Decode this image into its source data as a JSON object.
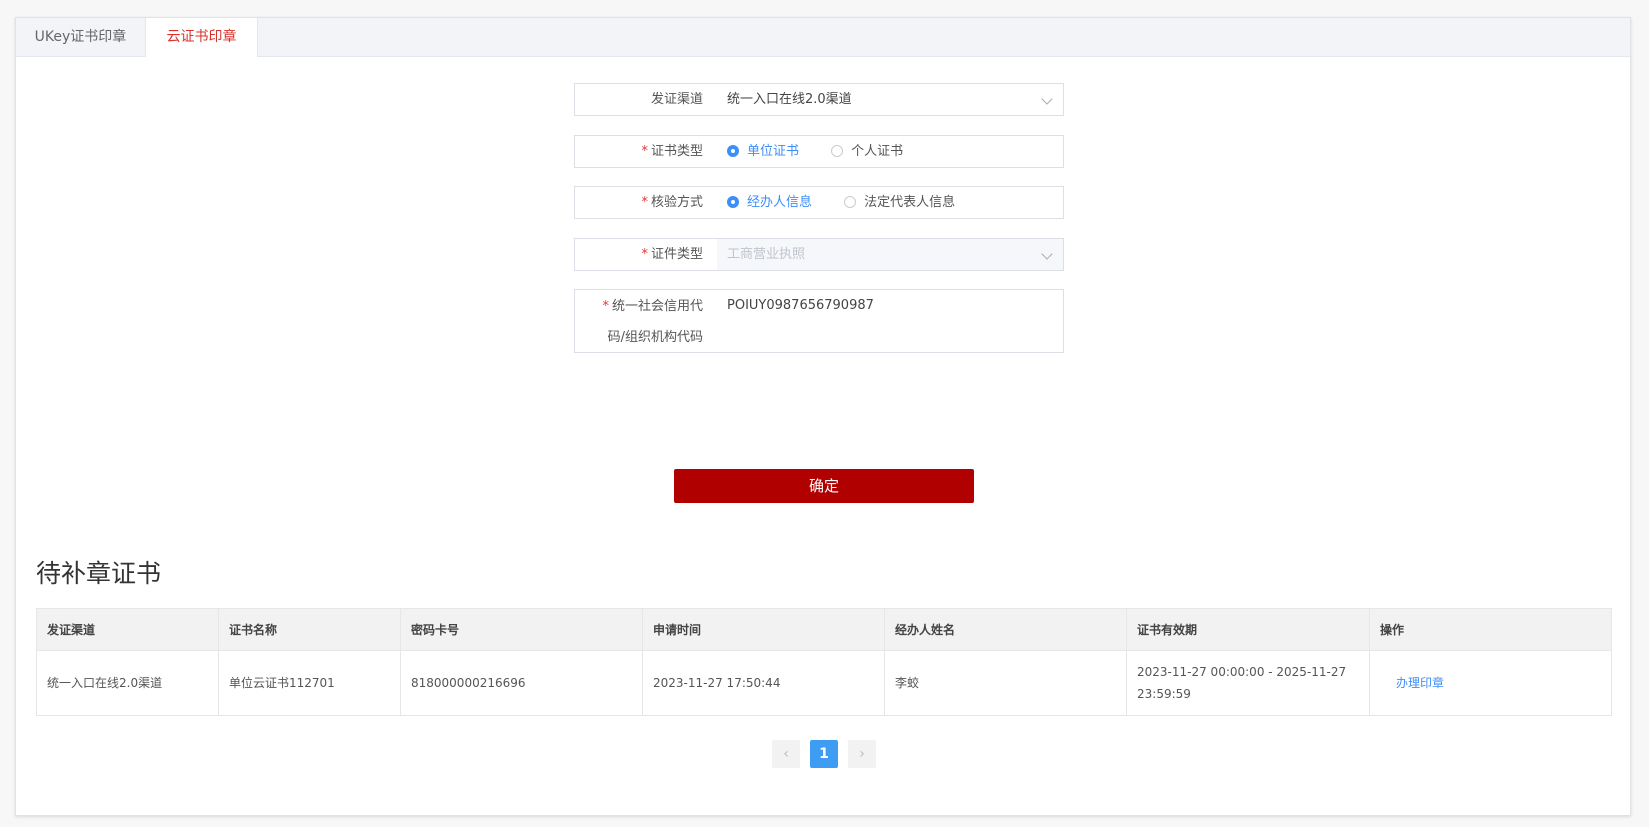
{
  "tabs": [
    {
      "label": "UKey证书印章",
      "active": false
    },
    {
      "label": "云证书印章",
      "active": true
    }
  ],
  "form": {
    "channel": {
      "label": "发证渠道",
      "value": "统一入口在线2.0渠道"
    },
    "cert_type": {
      "label": "证书类型",
      "options": [
        "单位证书",
        "个人证书"
      ],
      "selected": "单位证书"
    },
    "verify_method": {
      "label": "核验方式",
      "options": [
        "经办人信息",
        "法定代表人信息"
      ],
      "selected": "经办人信息"
    },
    "doc_type": {
      "label": "证件类型",
      "value": "工商营业执照"
    },
    "credit_code": {
      "label_line1": "统一社会信用代",
      "label_line2": "码/组织机构代码",
      "value": "POIUY0987656790987"
    },
    "required_mark": "*"
  },
  "confirm_label": "确定",
  "section_title": "待补章证书",
  "table": {
    "headers": [
      "发证渠道",
      "证书名称",
      "密码卡号",
      "申请时间",
      "经办人姓名",
      "证书有效期",
      "操作"
    ],
    "rows": [
      {
        "channel": "统一入口在线2.0渠道",
        "name": "单位云证书112701",
        "card": "818000000216696",
        "time": "2023-11-27 17:50:44",
        "agent": "李蛟",
        "validity": "2023-11-27 00:00:00 - 2025-11-27 23:59:59",
        "action": "办理印章"
      }
    ]
  },
  "pagination": {
    "prev": "‹",
    "current": "1",
    "next": "›"
  },
  "colors": {
    "accent": "#b00000",
    "tab_active": "#d9322b",
    "link": "#3e8ef7",
    "page_active": "#3e9cf3"
  }
}
